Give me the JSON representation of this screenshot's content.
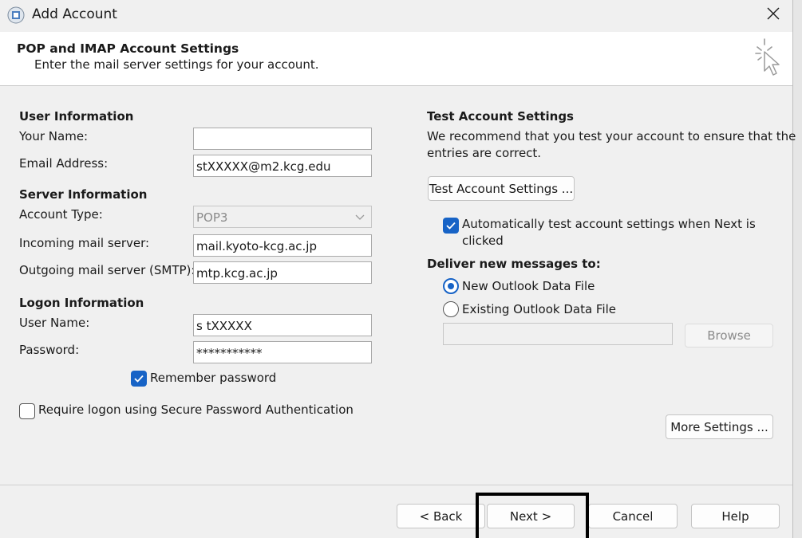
{
  "window": {
    "title": "Add Account",
    "app_icon": "outlook-account-icon",
    "close_icon": "close-icon"
  },
  "header": {
    "title": "POP and IMAP Account Settings",
    "subtitle": "Enter the mail server settings for your account.",
    "icon": "wizard-cursor-icon"
  },
  "user_info": {
    "heading": "User Information",
    "your_name_label": "Your Name:",
    "your_name_value": "",
    "email_label": "Email Address:",
    "email_value": "stXXXXX@m2.kcg.edu"
  },
  "server_info": {
    "heading": "Server Information",
    "account_type_label": "Account Type:",
    "account_type_value": "POP3",
    "incoming_label": "Incoming mail server:",
    "incoming_value": "mail.kyoto-kcg.ac.jp",
    "outgoing_label": "Outgoing mail server (SMTP):",
    "outgoing_value": "mtp.kcg.ac.jp"
  },
  "logon_info": {
    "heading": "Logon Information",
    "username_label": "User Name:",
    "username_value": "s tXXXXX",
    "password_label": "Password:",
    "password_value": "***********",
    "remember_label": "Remember password",
    "remember_checked": true,
    "spa_label": "Require logon using Secure Password Authentication",
    "spa_checked": false
  },
  "test": {
    "heading": "Test Account Settings",
    "description_line1": "We recommend that you test your account to ensure that the",
    "description_line2": "entries are correct.",
    "button": "Test Account Settings ...",
    "auto_test_line1": "Automatically test account settings when Next is",
    "auto_test_line2": "clicked",
    "auto_test_checked": true
  },
  "deliver": {
    "heading": "Deliver new messages to:",
    "options": [
      "New Outlook Data File",
      "Existing Outlook Data File"
    ],
    "selected": "New Outlook Data File",
    "path_value": "",
    "browse_button": "Browse"
  },
  "more_settings_button": "More Settings ...",
  "footer": {
    "back": "< Back",
    "next": "Next >",
    "cancel": "Cancel",
    "help": "Help"
  },
  "colors": {
    "accent": "#1763c6",
    "highlight_box": "#000000"
  }
}
